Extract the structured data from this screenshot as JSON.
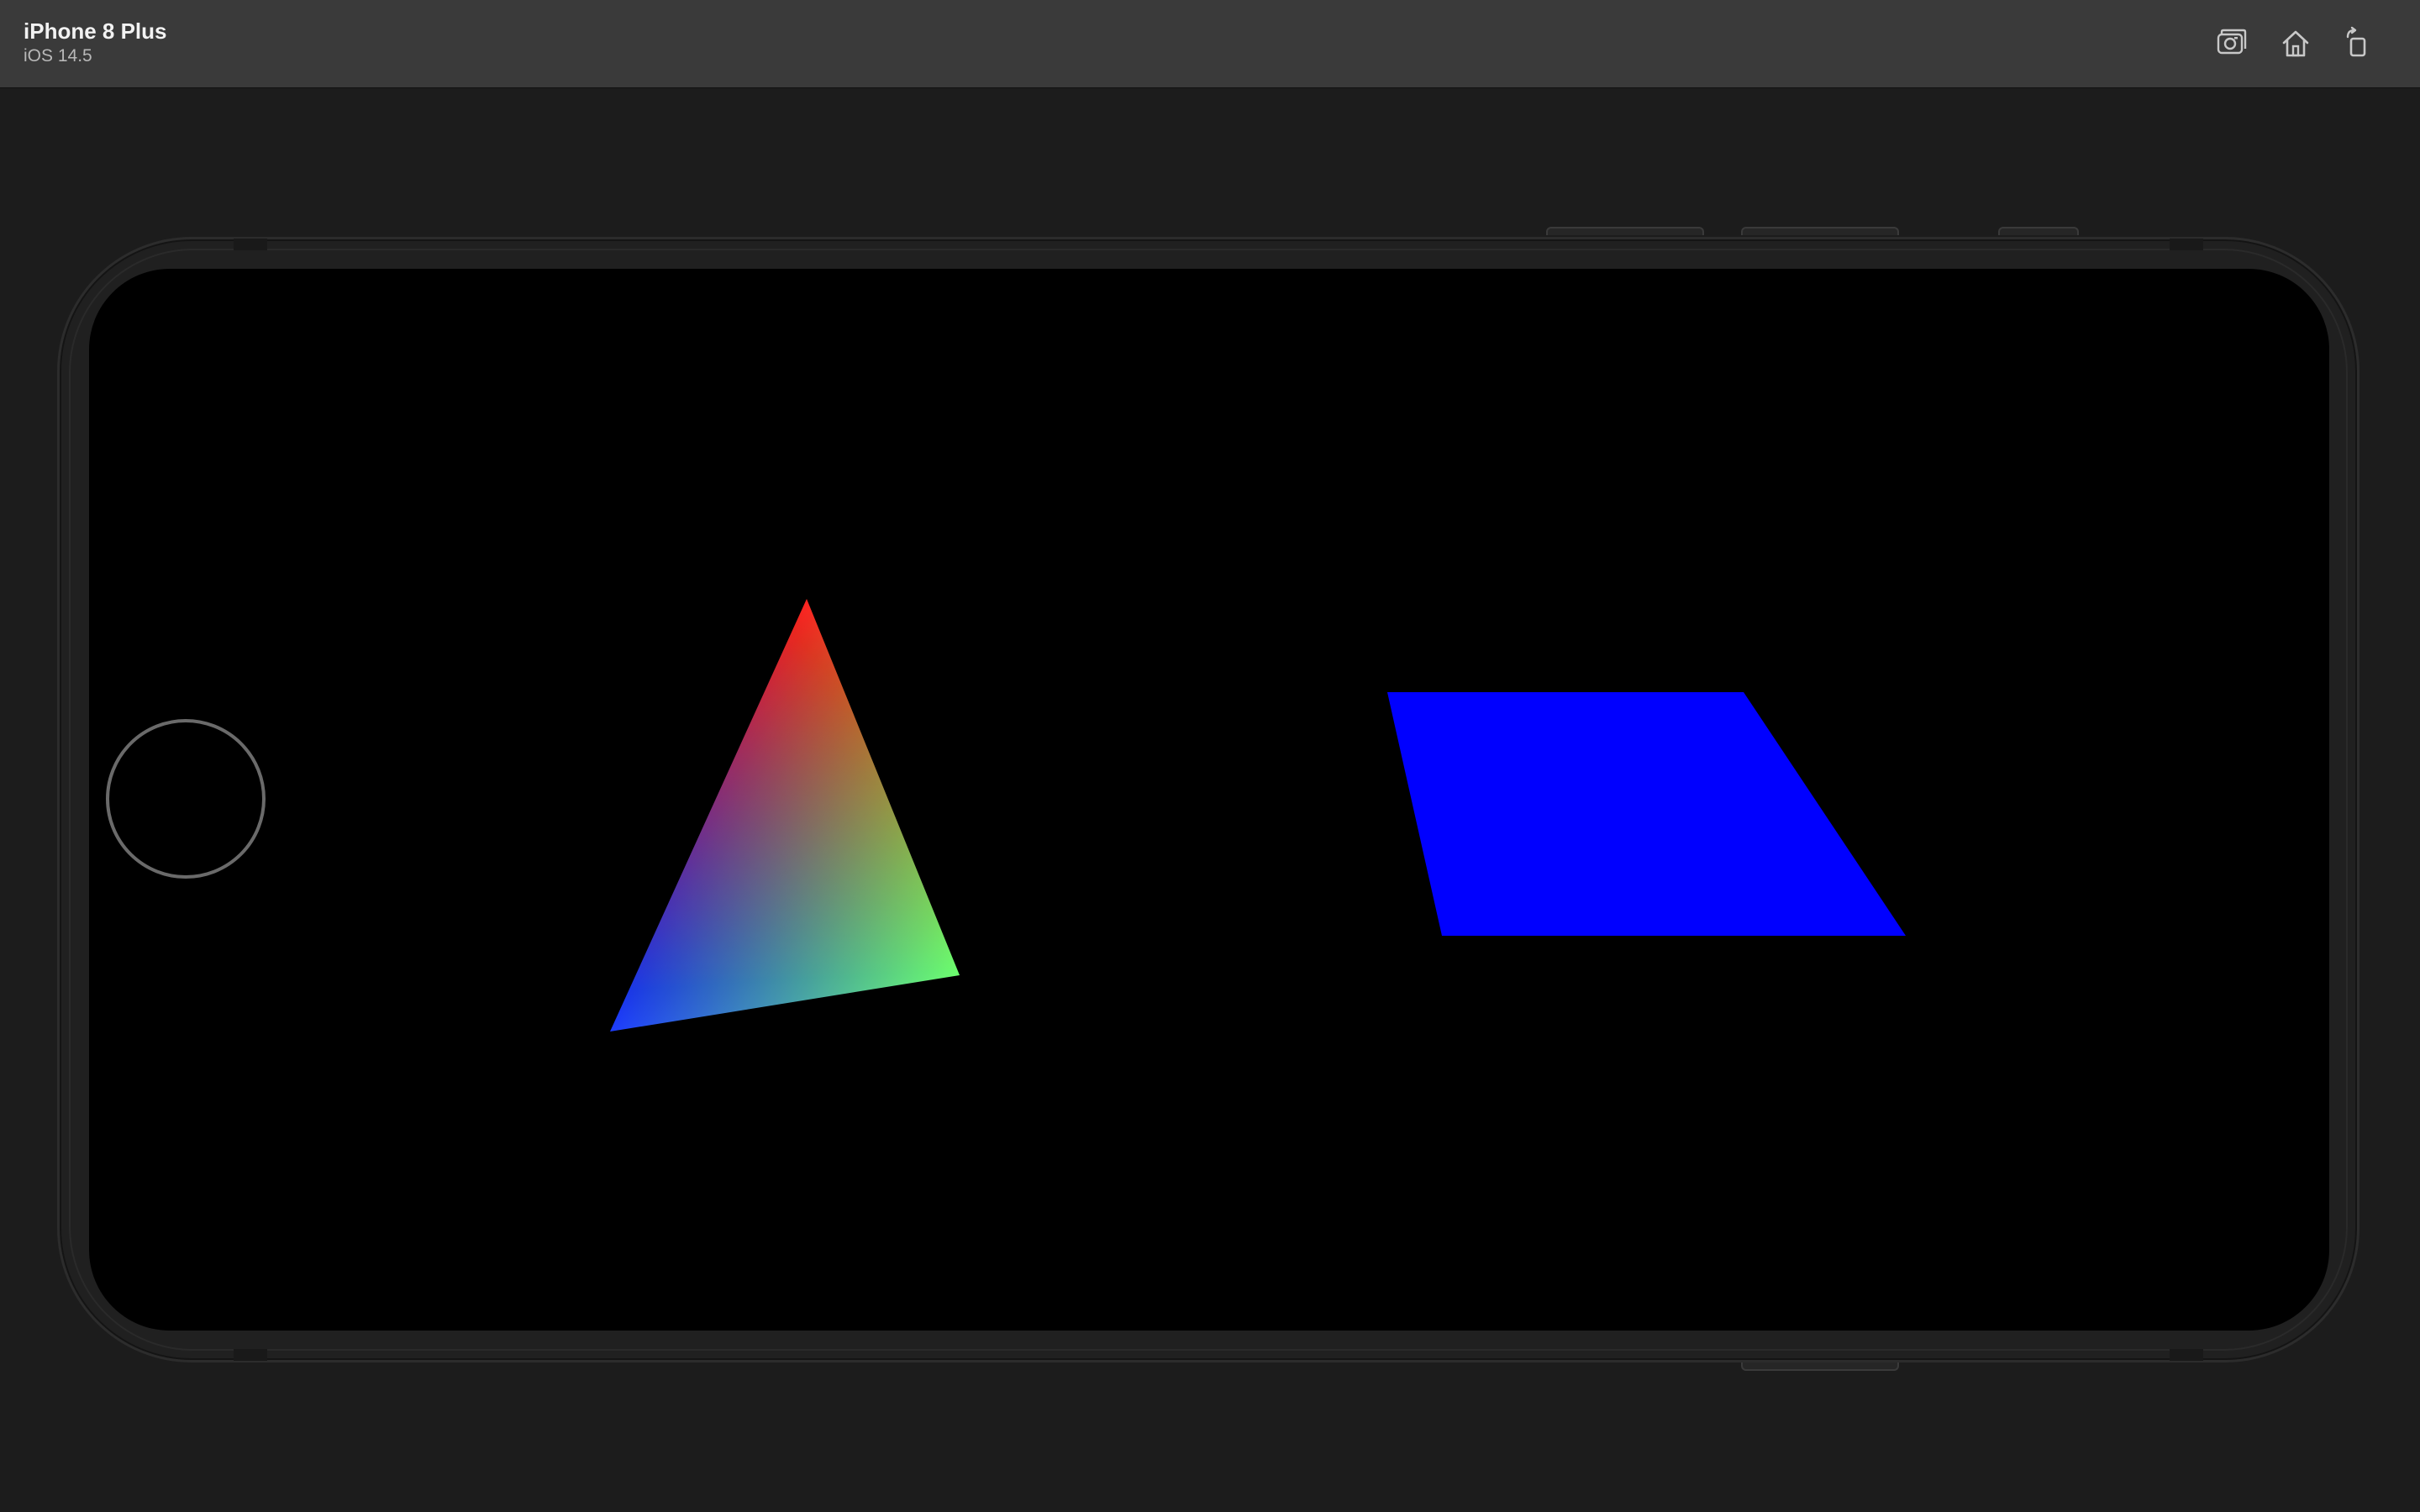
{
  "window": {
    "device_name": "iPhone 8 Plus",
    "os_version": "iOS 14.5"
  },
  "toolbar": {
    "buttons": [
      {
        "name": "screenshot",
        "icon": "camera-icon"
      },
      {
        "name": "home",
        "icon": "home-icon"
      },
      {
        "name": "rotate",
        "icon": "rotate-icon"
      }
    ]
  },
  "scene": {
    "background": "#000000",
    "triangle": {
      "vertex_colors": [
        "#ff2020",
        "#0a10ff",
        "#6cff40"
      ]
    },
    "parallelogram": {
      "fill": "#0000ff"
    }
  },
  "colors": {
    "titlebar": "#3a3a3a",
    "simulator_background": "#1c1c1c",
    "toolbar_icon": "#c8c8c8"
  }
}
